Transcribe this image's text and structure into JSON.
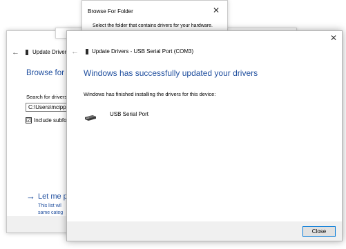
{
  "back_window": {
    "title": "Update Driver",
    "heading": "Browse for d",
    "search_label": "Search for drivers",
    "path_value": "C:\\Users\\mcipp",
    "include_subfolders_label": "Include subfol",
    "include_subfolders_checked": true,
    "checkbox_mark": "☑",
    "link_arrow": "→",
    "link_title": "Let me p",
    "link_desc_line1": "This list wil",
    "link_desc_line2": "same categ",
    "back_arrow": "←"
  },
  "browse_dialog": {
    "title": "Browse For Folder",
    "close_glyph": "✕",
    "description": "Select the folder that contains drivers for your hardware."
  },
  "front_window": {
    "close_glyph": "✕",
    "back_arrow": "←",
    "title": "Update Drivers - USB Serial Port (COM3)",
    "heading": "Windows has successfully updated your drivers",
    "finished_text": "Windows has finished installing the drivers for this device:",
    "device_name": "USB Serial Port",
    "device_icon": "usb-device-icon",
    "close_button_label": "Close"
  },
  "colors": {
    "accent_blue": "#1f4e9e",
    "button_border": "#0078d7",
    "footer_bg": "#f0f0f0"
  }
}
